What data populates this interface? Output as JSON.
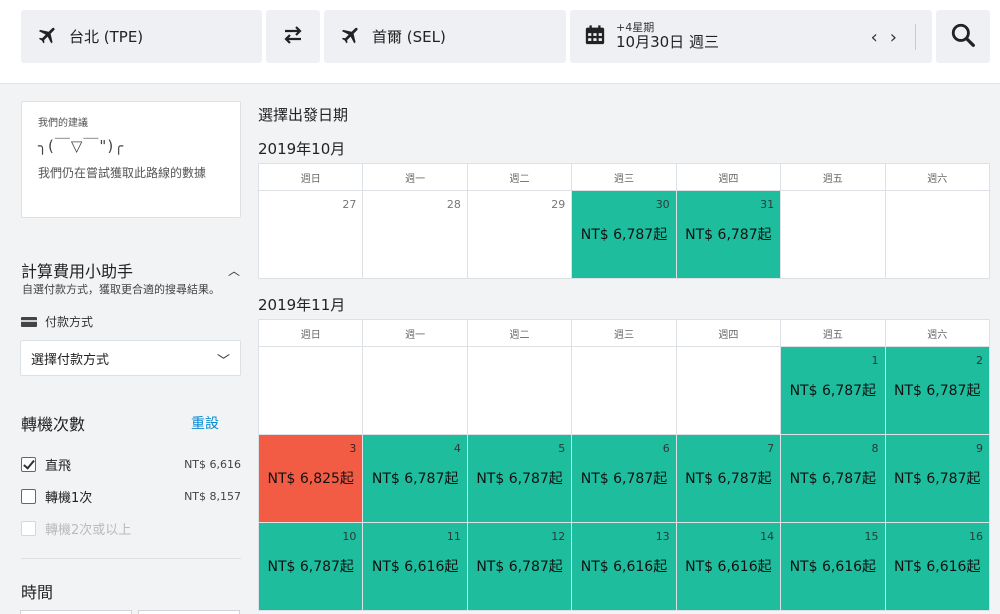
{
  "search": {
    "origin": "台北 (TPE)",
    "destination": "首爾 (SEL)",
    "date_offset": "+4星期",
    "date": "10月30日 週三"
  },
  "suggestion": {
    "title": "我們的建議",
    "face": "╮(￣▽￣\")╭",
    "message": "我們仍在嘗試獲取此路線的數據"
  },
  "fee_helper": {
    "title": "計算費用小助手",
    "subtitle": "自選付款方式，獲取更合適的搜尋結果。",
    "payment_label": "付款方式",
    "payment_select": "選擇付款方式"
  },
  "stops": {
    "title": "轉機次數",
    "reset": "重設",
    "options": [
      {
        "label": "直飛",
        "price": "NT$ 6,616",
        "checked": true
      },
      {
        "label": "轉機1次",
        "price": "NT$ 8,157",
        "checked": false
      },
      {
        "label": "轉機2次或以上",
        "price": "",
        "checked": false
      }
    ]
  },
  "time": {
    "title": "時間"
  },
  "calendar": {
    "heading": "選擇出發日期",
    "weekdays": [
      "週日",
      "週一",
      "週二",
      "週三",
      "週四",
      "週五",
      "週六"
    ],
    "months": [
      {
        "label": "2019年10月",
        "weeks": [
          [
            {
              "day": "27",
              "price": "",
              "status": "none"
            },
            {
              "day": "28",
              "price": "",
              "status": "none"
            },
            {
              "day": "29",
              "price": "",
              "status": "none"
            },
            {
              "day": "30",
              "price": "NT$ 6,787起",
              "status": "available"
            },
            {
              "day": "31",
              "price": "NT$ 6,787起",
              "status": "available"
            },
            {
              "day": "",
              "price": "",
              "status": "none"
            },
            {
              "day": "",
              "price": "",
              "status": "none"
            }
          ]
        ]
      },
      {
        "label": "2019年11月",
        "weeks": [
          [
            {
              "day": "",
              "price": "",
              "status": "none"
            },
            {
              "day": "",
              "price": "",
              "status": "none"
            },
            {
              "day": "",
              "price": "",
              "status": "none"
            },
            {
              "day": "",
              "price": "",
              "status": "none"
            },
            {
              "day": "",
              "price": "",
              "status": "none"
            },
            {
              "day": "1",
              "price": "NT$ 6,787起",
              "status": "available"
            },
            {
              "day": "2",
              "price": "NT$ 6,787起",
              "status": "available"
            }
          ],
          [
            {
              "day": "3",
              "price": "NT$ 6,825起",
              "status": "highlight"
            },
            {
              "day": "4",
              "price": "NT$ 6,787起",
              "status": "available"
            },
            {
              "day": "5",
              "price": "NT$ 6,787起",
              "status": "available"
            },
            {
              "day": "6",
              "price": "NT$ 6,787起",
              "status": "available"
            },
            {
              "day": "7",
              "price": "NT$ 6,787起",
              "status": "available"
            },
            {
              "day": "8",
              "price": "NT$ 6,787起",
              "status": "available"
            },
            {
              "day": "9",
              "price": "NT$ 6,787起",
              "status": "available"
            }
          ],
          [
            {
              "day": "10",
              "price": "NT$ 6,787起",
              "status": "available"
            },
            {
              "day": "11",
              "price": "NT$ 6,616起",
              "status": "available"
            },
            {
              "day": "12",
              "price": "NT$ 6,787起",
              "status": "available"
            },
            {
              "day": "13",
              "price": "NT$ 6,616起",
              "status": "available"
            },
            {
              "day": "14",
              "price": "NT$ 6,616起",
              "status": "available"
            },
            {
              "day": "15",
              "price": "NT$ 6,616起",
              "status": "available"
            },
            {
              "day": "16",
              "price": "NT$ 6,616起",
              "status": "available"
            }
          ]
        ]
      }
    ]
  },
  "colors": {
    "available": "#1ebd9e",
    "highlight": "#f25c45",
    "link": "#0a8bd1"
  },
  "icons": {
    "origin": "airplane-icon",
    "swap": "swap-arrows-icon",
    "destination": "airplane-icon",
    "date": "calendar-icon",
    "prev": "chevron-left-icon",
    "next": "chevron-right-icon",
    "search": "search-icon",
    "collapse": "chevron-up-icon",
    "payment": "credit-card-icon",
    "dropdown": "chevron-down-icon"
  }
}
